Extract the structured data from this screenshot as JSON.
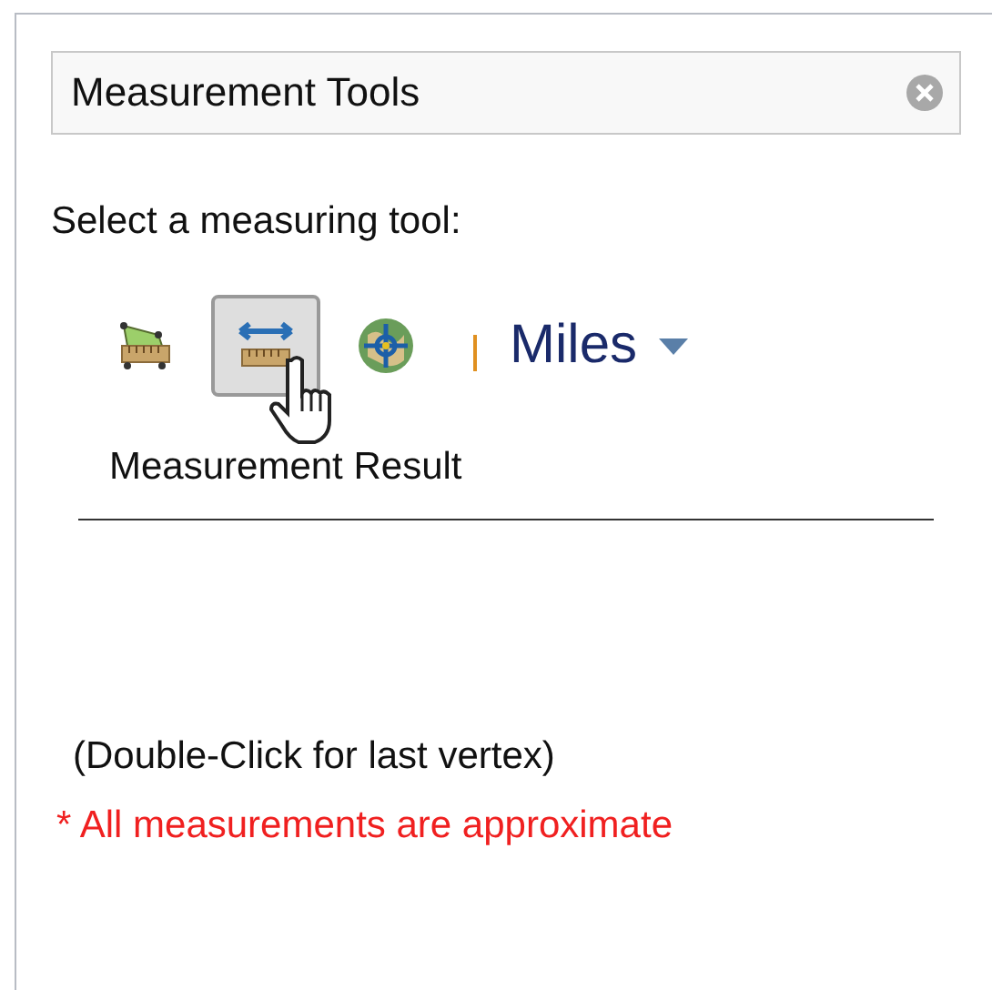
{
  "search": {
    "value": "Measurement Tools"
  },
  "prompt": "Select a measuring tool:",
  "tools": [
    {
      "kind": "area",
      "selected": false
    },
    {
      "kind": "distance",
      "selected": true
    },
    {
      "kind": "location",
      "selected": false
    }
  ],
  "unit": {
    "label": "Miles"
  },
  "result_label": "Measurement Result",
  "hint": "(Double-Click for last vertex)",
  "note": "* All measurements are approximate"
}
